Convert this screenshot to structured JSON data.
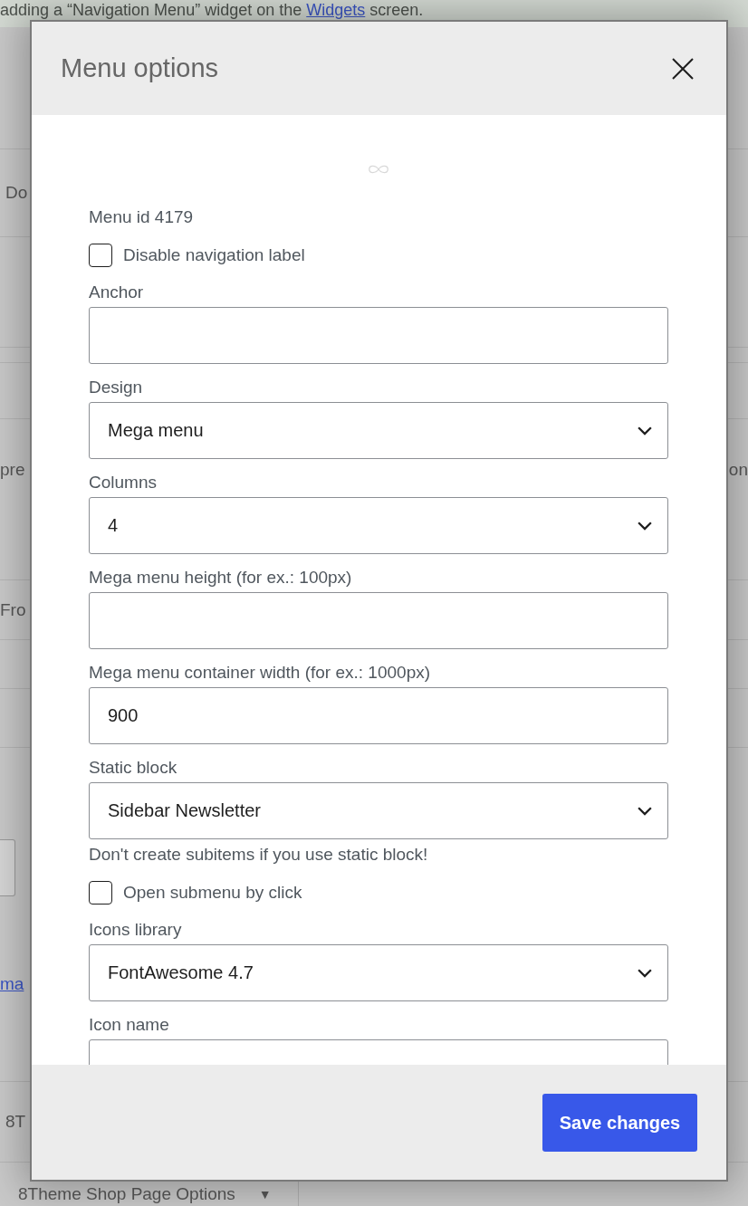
{
  "background": {
    "notice": {
      "text": "adding a “Navigation Menu” widget on the",
      "link": "Widgets",
      "after": "screen."
    },
    "rows": [
      {
        "kind": "text",
        "left": "Do"
      },
      {
        "kind": "text",
        "left": "pre",
        "right": "on"
      },
      {
        "kind": "text",
        "left": "Fro"
      },
      {
        "kind": "field_link",
        "link": "ma"
      },
      {
        "kind": "text",
        "left": "8T"
      }
    ],
    "panel": {
      "title": "8Theme Shop Page Options",
      "caret": "▼"
    }
  },
  "dialog": {
    "title": "Menu options",
    "fields": [
      {
        "kind": "text",
        "text": "Menu id 4179"
      },
      {
        "kind": "checkbox",
        "label": "Disable navigation label",
        "checked": false
      },
      {
        "kind": "input",
        "label": "Anchor"
      },
      {
        "kind": "select",
        "label": "Design",
        "value": "Mega menu"
      },
      {
        "kind": "select",
        "label": "Columns",
        "value": "4"
      },
      {
        "kind": "input",
        "label": "Mega menu height (for ex.: 100px)"
      },
      {
        "kind": "input",
        "label": "Mega menu container width (for ex.: 1000px)",
        "value": "900"
      },
      {
        "kind": "select",
        "label": "Static block",
        "value": "Sidebar Newsletter"
      },
      {
        "kind": "note",
        "text": "Don't create subitems if you use static block!"
      },
      {
        "kind": "checkbox",
        "label": "Open submenu by click",
        "checked": false
      },
      {
        "kind": "select",
        "label": "Icons library",
        "value": "FontAwesome 4.7"
      },
      {
        "kind": "input",
        "label": "Icon name"
      }
    ],
    "save_button": "Save changes"
  }
}
